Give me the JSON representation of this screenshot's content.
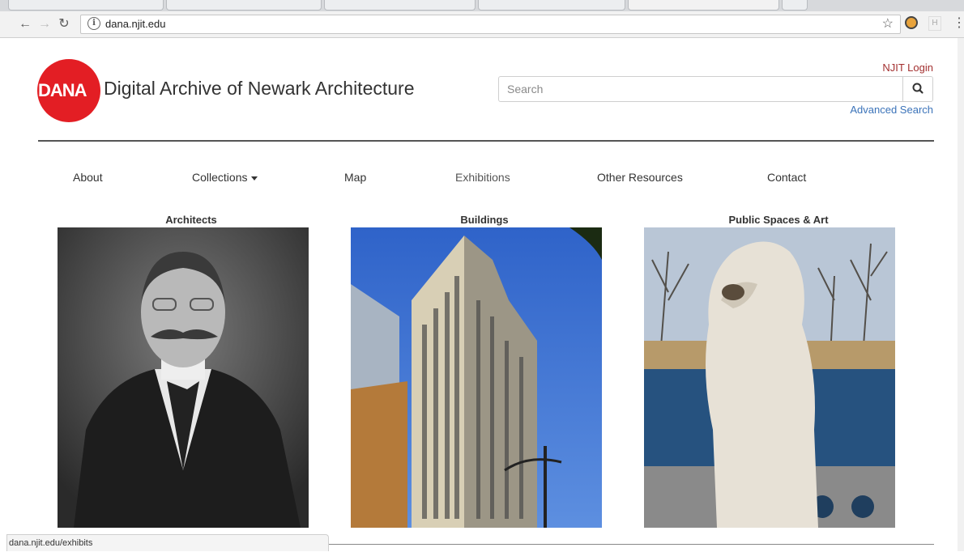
{
  "browser": {
    "url": "dana.njit.edu",
    "status_url": "dana.njit.edu/exhibits",
    "extension_letter": "H"
  },
  "site": {
    "logo_text": "DANA",
    "title": "Digital Archive of Newark Architecture",
    "login_label": "NJIT Login",
    "search_placeholder": "Search",
    "advanced_search_label": "Advanced Search"
  },
  "nav": {
    "items": [
      "About",
      "Collections",
      "Map",
      "Exhibitions",
      "Other Resources",
      "Contact"
    ]
  },
  "categories": [
    {
      "title": "Architects"
    },
    {
      "title": "Buildings"
    },
    {
      "title": "Public Spaces & Art"
    }
  ],
  "colors": {
    "brand_red": "#e31e24",
    "login_red": "#a33030",
    "link_blue": "#3b73b9"
  }
}
